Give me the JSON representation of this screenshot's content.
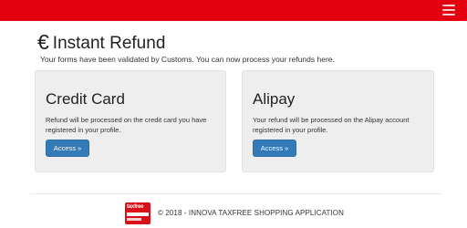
{
  "header": {
    "brand_color": "#e3000f",
    "menu_icon": "hamburger-menu-icon"
  },
  "main": {
    "title_symbol": "€",
    "title": "Instant Refund",
    "subtitle": "Your forms have been validated by Customs. You can now process your refunds here."
  },
  "cards": {
    "credit_card": {
      "title": "Credit Card",
      "description": "Refund will be processed on the credit card you have registered in your profile.",
      "button_label": "Access »"
    },
    "alipay": {
      "title": "Alipay",
      "description": "Your refund will be processed on the Alipay account registered in your profile.",
      "button_label": "Access »"
    }
  },
  "colors": {
    "accent": "#e3000f",
    "button": "#337ab7",
    "card_bg": "#eeeeee"
  },
  "footer": {
    "logo_icon": "taxfree-logo",
    "logo_text": "taxfree",
    "copyright": "© 2018 - INNOVA TAXFREE SHOPPING APPLICATION"
  }
}
